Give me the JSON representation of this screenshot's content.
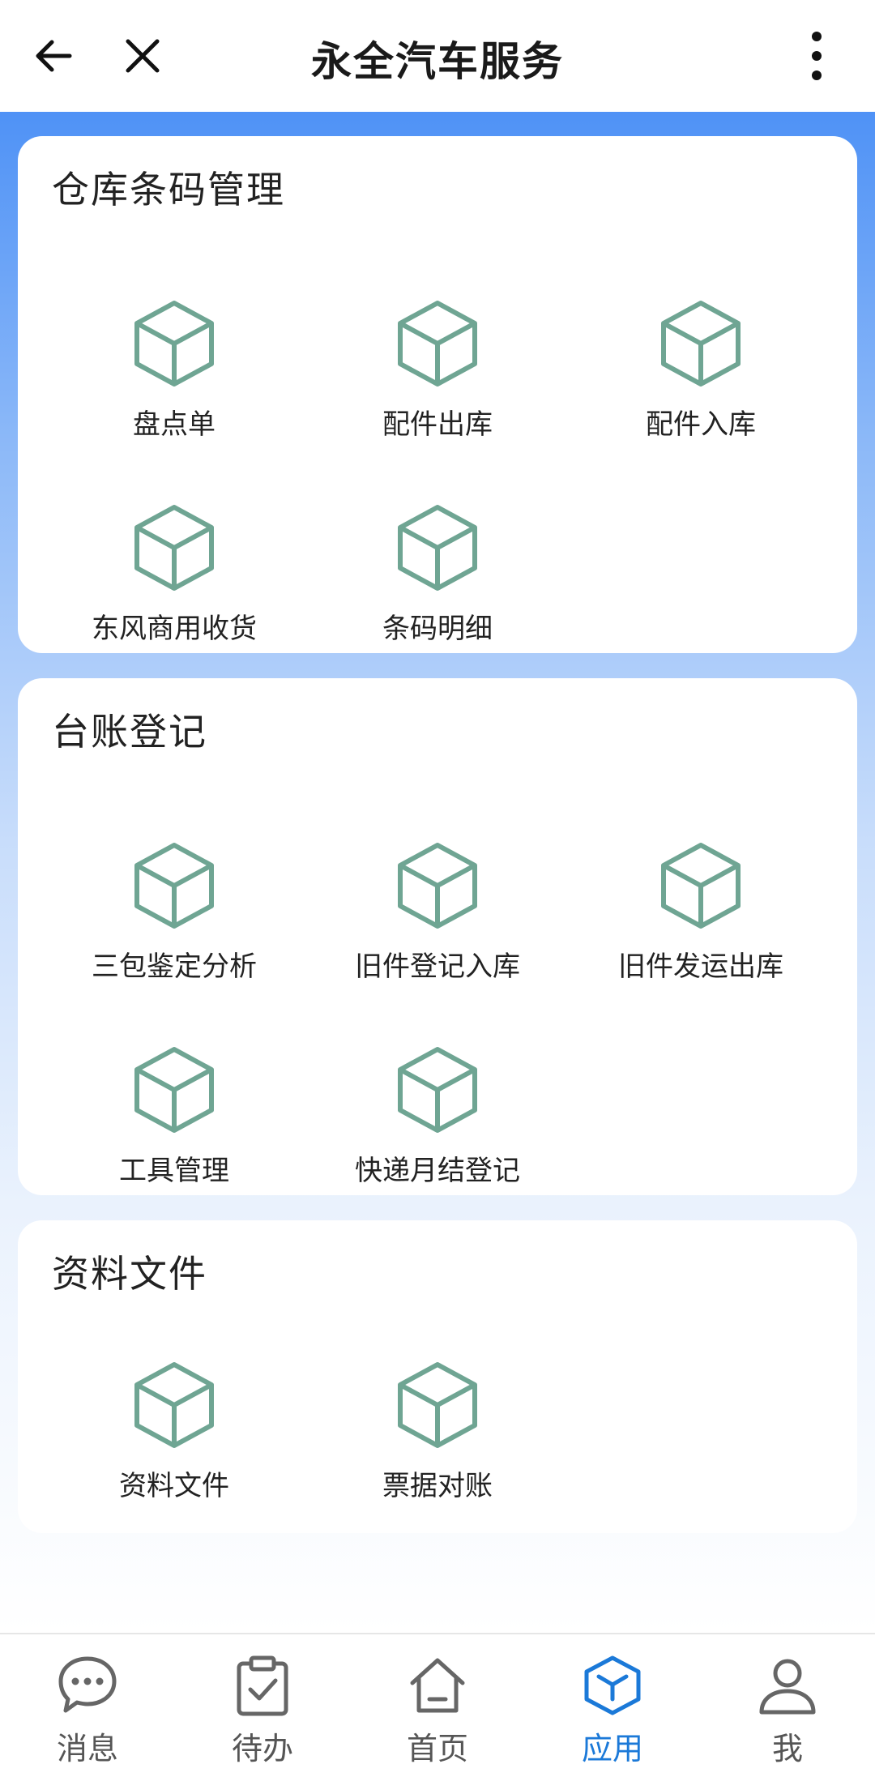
{
  "header": {
    "title": "永全汽车服务",
    "back_icon": "arrow-left-icon",
    "close_icon": "close-icon",
    "more_icon": "more-vertical-icon"
  },
  "colors": {
    "accent": "#1b79d8",
    "icon_stroke": "#6fa593",
    "gradient_top": "#4f92f6"
  },
  "sections": [
    {
      "title": "仓库条码管理",
      "items": [
        {
          "label": "盘点单",
          "icon": "cube-icon"
        },
        {
          "label": "配件出库",
          "icon": "cube-icon"
        },
        {
          "label": "配件入库",
          "icon": "cube-icon"
        },
        {
          "label": "东风商用收货",
          "icon": "cube-icon"
        },
        {
          "label": "条码明细",
          "icon": "cube-icon"
        }
      ]
    },
    {
      "title": "台账登记",
      "items": [
        {
          "label": "三包鉴定分析",
          "icon": "cube-icon"
        },
        {
          "label": "旧件登记入库",
          "icon": "cube-icon"
        },
        {
          "label": "旧件发运出库",
          "icon": "cube-icon"
        },
        {
          "label": "工具管理",
          "icon": "cube-icon"
        },
        {
          "label": "快递月结登记",
          "icon": "cube-icon"
        }
      ]
    },
    {
      "title": "资料文件",
      "items": [
        {
          "label": "资料文件",
          "icon": "cube-icon"
        },
        {
          "label": "票据对账",
          "icon": "cube-icon"
        }
      ]
    }
  ],
  "tabbar": {
    "tabs": [
      {
        "label": "消息",
        "icon": "chat-bubble-icon",
        "active": false
      },
      {
        "label": "待办",
        "icon": "clipboard-check-icon",
        "active": false
      },
      {
        "label": "首页",
        "icon": "home-icon",
        "active": false
      },
      {
        "label": "应用",
        "icon": "cube-icon",
        "active": true
      },
      {
        "label": "我",
        "icon": "user-icon",
        "active": false
      }
    ]
  }
}
